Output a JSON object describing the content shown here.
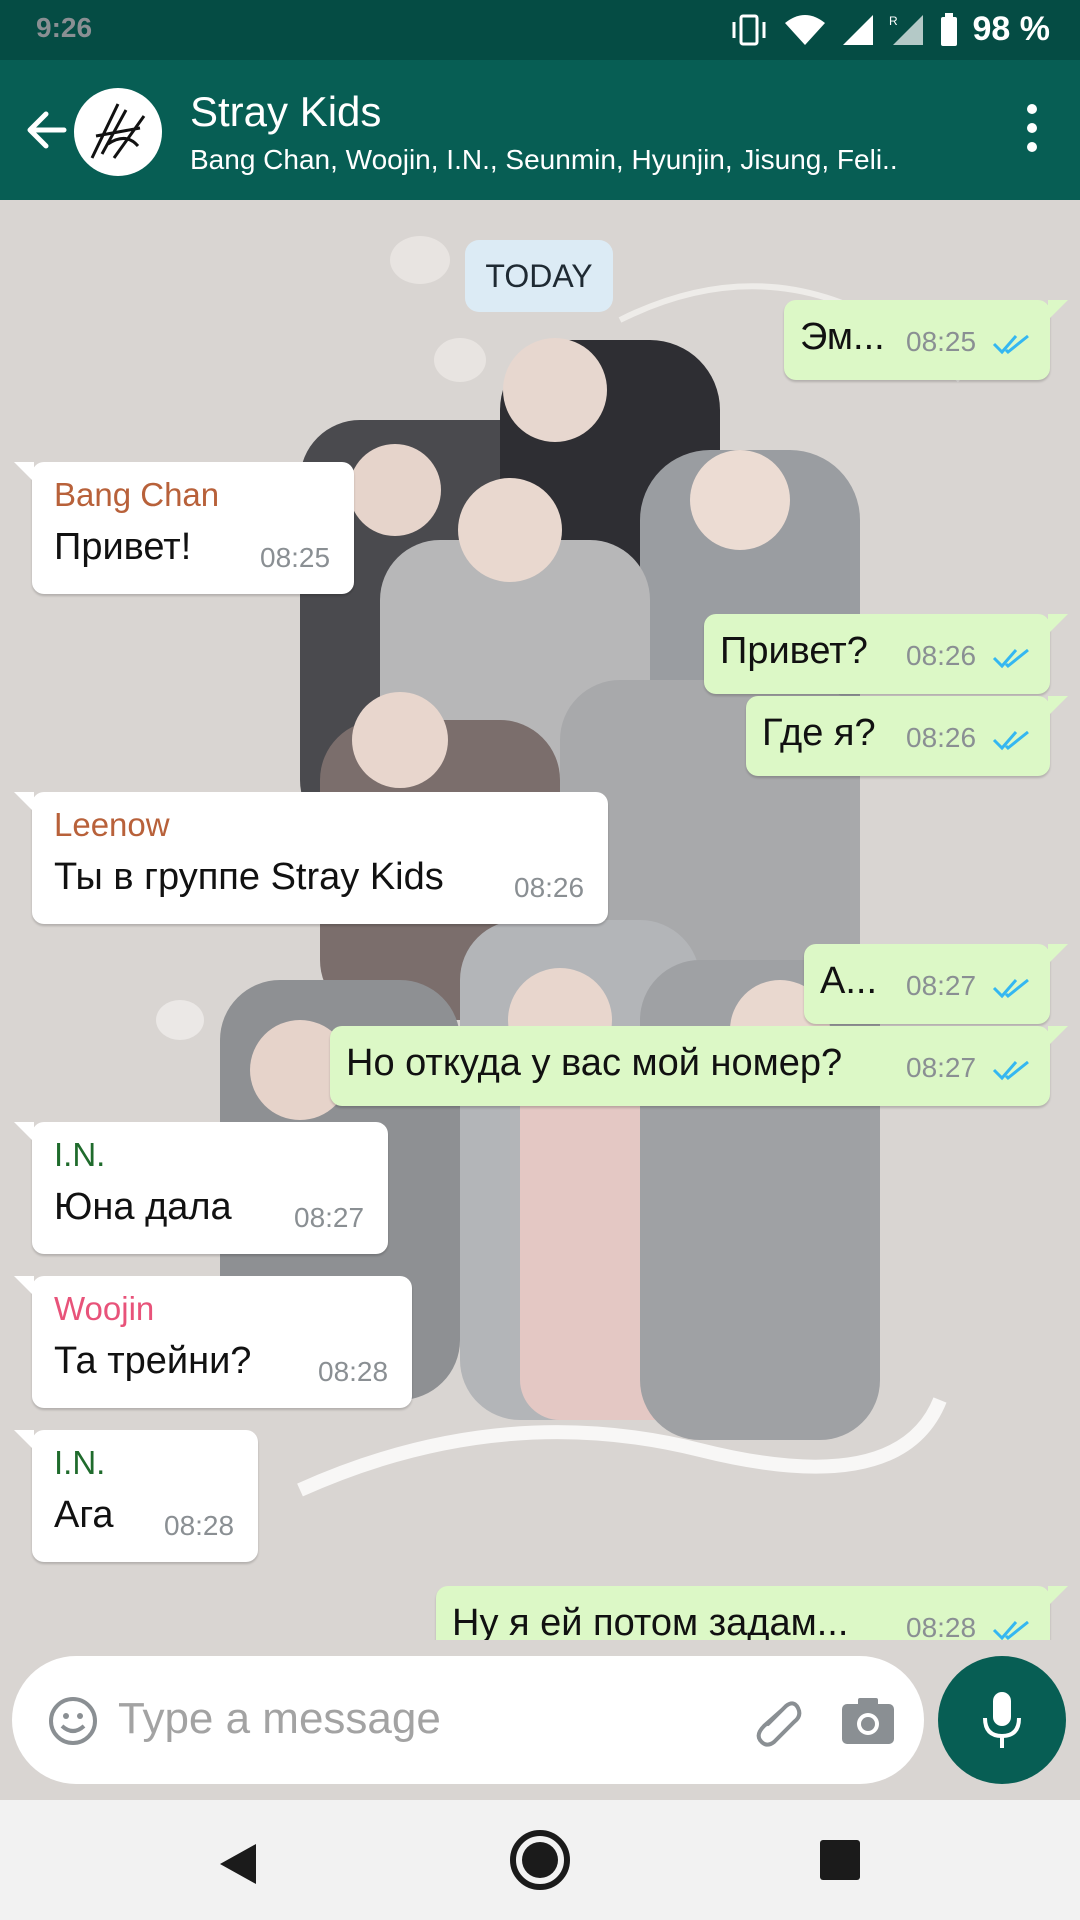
{
  "status_bar": {
    "time": "9:26",
    "battery": "98 %"
  },
  "header": {
    "title": "Stray Kids",
    "subtitle": "Bang Chan, Woojin, I.N., Seunmin, Hyunjin, Jisung, Feli.."
  },
  "chat": {
    "date_separator": "TODAY",
    "messages": [
      {
        "dir": "out",
        "text": "Эм...",
        "time": "08:25",
        "status": "read"
      },
      {
        "dir": "in",
        "sender": "Bang Chan",
        "sender_color": "#b8613a",
        "text": "Привет!",
        "time": "08:25"
      },
      {
        "dir": "out",
        "text": "Привет?",
        "time": "08:26",
        "status": "read"
      },
      {
        "dir": "out",
        "text": "Где я?",
        "time": "08:26",
        "status": "read"
      },
      {
        "dir": "in",
        "sender": "Leenow",
        "sender_color": "#b8613a",
        "text": "Ты в группе Stray Kids",
        "time": "08:26"
      },
      {
        "dir": "out",
        "text": "А...",
        "time": "08:27",
        "status": "read"
      },
      {
        "dir": "out",
        "text": "Но откуда у вас мой номер?",
        "time": "08:27",
        "status": "read"
      },
      {
        "dir": "in",
        "sender": "I.N.",
        "sender_color": "#1f6b2c",
        "text": "Юна дала",
        "time": "08:27"
      },
      {
        "dir": "in",
        "sender": "Woojin",
        "sender_color": "#e8537a",
        "text": "Та трейни?",
        "time": "08:28"
      },
      {
        "dir": "in",
        "sender": "I.N.",
        "sender_color": "#1f6b2c",
        "text": "Ага",
        "time": "08:28"
      },
      {
        "dir": "out",
        "text": "Ну я ей потом задам...",
        "time": "08:28",
        "status": "read"
      }
    ]
  },
  "composer": {
    "placeholder": "Type a message"
  },
  "colors": {
    "header": "#075e54",
    "status_bar": "#054c44",
    "outgoing": "#dcf8c6",
    "incoming": "#ffffff",
    "read_ticks": "#34b7f1"
  },
  "icons": [
    "back-arrow-icon",
    "menu-icon",
    "emoji-icon",
    "attach-icon",
    "camera-icon",
    "mic-icon",
    "nav-back-icon",
    "nav-home-icon",
    "nav-recent-icon"
  ]
}
